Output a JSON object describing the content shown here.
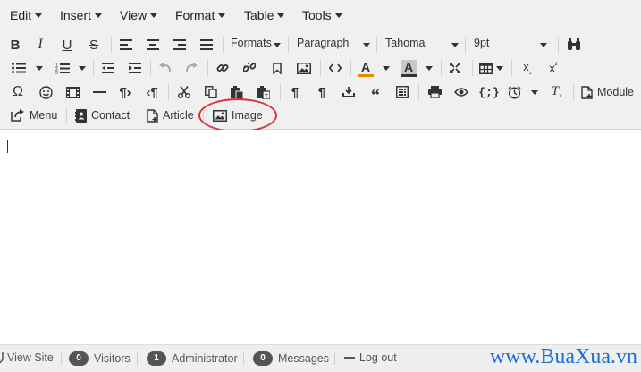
{
  "menubar": {
    "items": [
      {
        "label": "Edit"
      },
      {
        "label": "Insert"
      },
      {
        "label": "View"
      },
      {
        "label": "Format"
      },
      {
        "label": "Table"
      },
      {
        "label": "Tools"
      }
    ]
  },
  "toolbar": {
    "formats_label": "Formats",
    "block_format": "Paragraph",
    "font_family": "Tahoma",
    "font_size": "9pt",
    "module_label": "Module",
    "menu_label": "Menu",
    "contact_label": "Contact",
    "article_label": "Article",
    "image_label": "Image",
    "text_color_glyph": "A",
    "bg_color_glyph": "A",
    "text_color": "#e88b00",
    "bg_color": "#333333",
    "highlight_color": "#d9333a"
  },
  "statusbar": {
    "view_site": "View Site",
    "visitors_count": "0",
    "visitors_label": "Visitors",
    "admin_count": "1",
    "admin_label": "Administrator",
    "messages_count": "0",
    "messages_label": "Messages",
    "logout_label": "Log out"
  },
  "watermark": "www.BuaXua.vn"
}
